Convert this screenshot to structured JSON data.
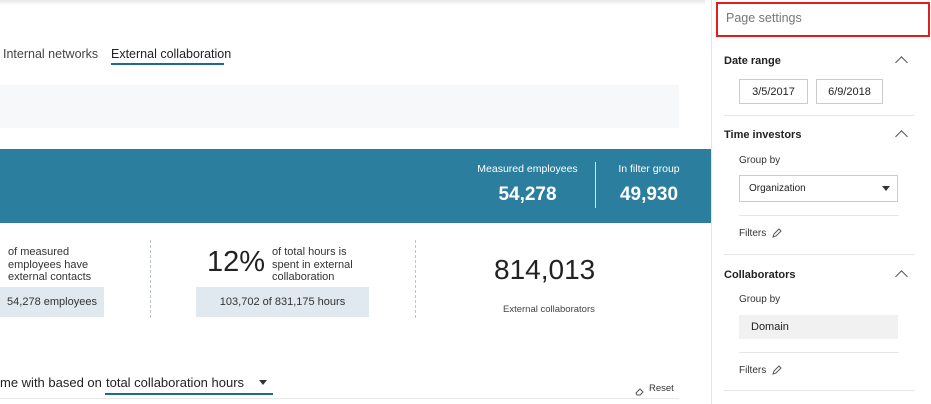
{
  "tabs": [
    {
      "label": "Internal networks",
      "active": false
    },
    {
      "label": "External collaboration",
      "active": true
    }
  ],
  "banner": {
    "measured_label": "Measured employees",
    "measured_value": "54,278",
    "filter_label": "In filter group",
    "filter_value": "49,930",
    "color": "#2b7e9e"
  },
  "cards": {
    "employees_text": "of measured employees have external contacts",
    "employees_pill": "54,278 employees",
    "hours_pct": "12%",
    "hours_text": "of total hours is spent in external collaboration",
    "hours_pill_value": "103,702",
    "hours_pill_of": "of 831,175 hours",
    "collaborators_value": "814,013",
    "collaborators_label": "External collaborators"
  },
  "bottom": {
    "prefix": "me with based on",
    "dropdown_value": "total collaboration hours",
    "reset_label": "Reset"
  },
  "panel": {
    "title": "Page settings",
    "date_range": {
      "title": "Date range",
      "start": "3/5/2017",
      "end": "6/9/2018"
    },
    "time_investors": {
      "title": "Time investors",
      "group_by_label": "Group by",
      "group_by_value": "Organization",
      "filters_label": "Filters"
    },
    "collaborators": {
      "title": "Collaborators",
      "group_by_label": "Group by",
      "group_by_value": "Domain",
      "filters_label": "Filters"
    }
  }
}
